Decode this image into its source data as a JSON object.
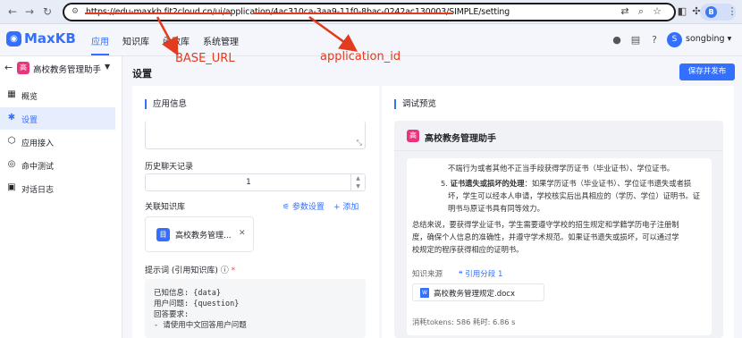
{
  "browser": {
    "url_prefix": "https://edu-maxkb.fit2cloud.cn/ui/application/",
    "url_id": "4ac310ca-3aa9-11f0-8bac-0242ac130003",
    "url_suffix": "/SIMPLE/setting",
    "profile_initial": "B"
  },
  "header": {
    "logo": "MaxKB",
    "nav": [
      "应用",
      "知识库",
      "函数库",
      "系统管理"
    ],
    "user_initial": "S",
    "user_name": "songbing ▾"
  },
  "sidebar": {
    "app_badge": "高",
    "app_name": "高校教务管理助手",
    "items": [
      {
        "label": "概览",
        "icon": "grid-icon"
      },
      {
        "label": "设置",
        "icon": "gear-icon"
      },
      {
        "label": "应用接入",
        "icon": "cube-icon"
      },
      {
        "label": "命中测试",
        "icon": "target-icon"
      },
      {
        "label": "对话日志",
        "icon": "log-icon"
      }
    ]
  },
  "main": {
    "title": "设置",
    "save_button": "保存并发布",
    "app_info": {
      "section_title": "应用信息",
      "history_label": "历史聊天记录",
      "history_value": "1",
      "kb_label": "关联知识库",
      "param_link": "⚟ 参数设置",
      "add_link": "+ 添加",
      "kb_card_name": "高校教务管理...",
      "kb_icon": "目",
      "prompt_label": "提示词 (引用知识库) ⓘ",
      "prompt_required": "*",
      "prompt_lines": [
        "已知信息: {data}",
        "用户问题: {question}",
        "回答要求:",
        "  - 请使用中文回答用户问题"
      ]
    },
    "preview": {
      "section_title": "调试预览",
      "chat_badge": "高",
      "chat_title": "高校教务管理助手",
      "msg_lines": [
        "不端行为或者其他不正当手段获得学历证书（毕业证书）、学位证书。",
        "5. ",
        "证书遗失或损坏的处理",
        "：如果学历证书（毕业证书）、学位证书遗失或者损",
        "坏，学生可以经本人申请，学校核实后出具相应的（学历、学位）证明书。证",
        "明书与原证书具有同等效力。",
        "总结来说，要获得学业证书，学生需要遵守学校的招生规定和学籍学历电子注册制",
        "度，确保个人信息的准确性，并遵守学术规范。如果证书遗失或损坏，可以通过学",
        "校规定的程序获得相应的证明书。"
      ],
      "source_label": "知识来源",
      "cite_link": "❝ 引用分段 1",
      "doc_name": "高校教务管理规定.docx",
      "doc_icon": "W",
      "stats": "消耗tokens: 586  耗时: 6.86 s"
    }
  },
  "annotations": {
    "base_url": "BASE_URL",
    "application_id": "application_id",
    "color": "#e23b1e"
  }
}
